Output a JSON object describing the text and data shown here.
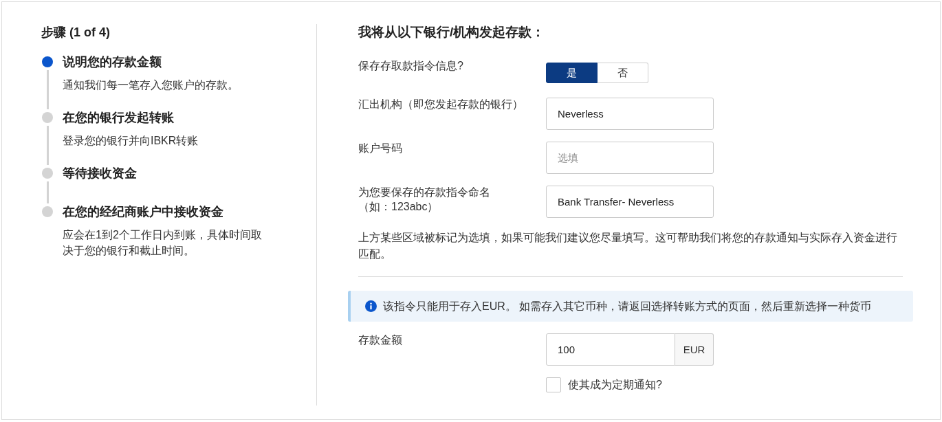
{
  "steps_panel": {
    "title": "步骤 (1 of 4)",
    "steps": [
      {
        "title": "说明您的存款金额",
        "description": "通知我们每一笔存入您账户的存款。",
        "active": true
      },
      {
        "title": "在您的银行发起转账",
        "description": "登录您的银行并向IBKR转账",
        "active": false
      },
      {
        "title": "等待接收资金",
        "active": false
      },
      {
        "title": "在您的经纪商账户中接收资金",
        "description": "应会在1到2个工作日内到账，具体时间取决于您的银行和截止时间。",
        "active": false
      }
    ]
  },
  "form": {
    "heading": "我将从以下银行/机构发起存款：",
    "fields": [
      {
        "kind": "toggle",
        "label": "保存存取款指令信息?",
        "options": [
          {
            "label": "是",
            "selected": true
          },
          {
            "label": "否",
            "selected": false
          }
        ]
      },
      {
        "kind": "text",
        "label": "汇出机构（即您发起存款的银行）",
        "value": "Neverless"
      },
      {
        "kind": "text",
        "label": "账户号码",
        "placeholder": "选填"
      },
      {
        "kind": "text",
        "label": "为您要保存的存款指令命名",
        "example": "（如：123abc）",
        "value": "Bank Transfer- Neverless"
      }
    ],
    "note": "上方某些区域被标记为选填，如果可能我们建议您尽量填写。这可帮助我们将您的存款通知与实际存入资金进行匹配。",
    "info": "该指令只能用于存入EUR。 如需存入其它币种，请返回选择转账方式的页面，然后重新选择一种货币",
    "amount": {
      "label": "存款金额",
      "value": "100",
      "currency": "EUR"
    },
    "recurring": {
      "label": "使其成为定期通知?",
      "checked": false
    }
  }
}
